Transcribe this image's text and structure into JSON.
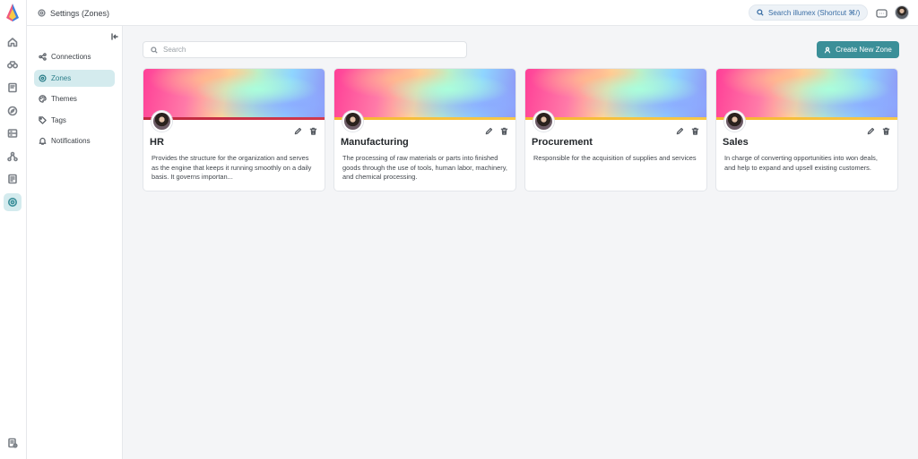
{
  "header": {
    "title": "Settings (Zones)",
    "search_label": "Search illumex (Shortcut ⌘/)"
  },
  "rail": {
    "icons": [
      "home-icon",
      "binoculars-icon",
      "book-icon",
      "compass-icon",
      "list-icon",
      "graph-icon",
      "report-icon",
      "settings-icon",
      "docs-icon"
    ],
    "active": "settings-icon"
  },
  "settings_nav": {
    "items": [
      {
        "label": "Connections",
        "icon": "connections-icon"
      },
      {
        "label": "Zones",
        "icon": "zones-icon",
        "active": true
      },
      {
        "label": "Themes",
        "icon": "palette-icon"
      },
      {
        "label": "Tags",
        "icon": "tag-icon"
      },
      {
        "label": "Notifications",
        "icon": "bell-icon"
      }
    ]
  },
  "main": {
    "search_placeholder": "Search",
    "create_label": "Create New Zone",
    "accent_color": "#3b8f98"
  },
  "zones": [
    {
      "name": "HR",
      "description": "Provides the structure for the organization and serves as the engine that keeps it running smoothly on a daily basis. It governs importan...",
      "banner_stripe": "#c0263d"
    },
    {
      "name": "Manufacturing",
      "description": "The processing of raw materials or parts into finished goods through the use of tools, human labor, machinery, and chemical processing.",
      "banner_stripe": "#f6b62f"
    },
    {
      "name": "Procurement",
      "description": "Responsible for the acquisition of supplies and services",
      "banner_stripe": "#f6b62f"
    },
    {
      "name": "Sales",
      "description": "In charge of converting opportunities into won deals, and help to expand and upsell existing customers.",
      "banner_stripe": "#f6b62f"
    }
  ]
}
